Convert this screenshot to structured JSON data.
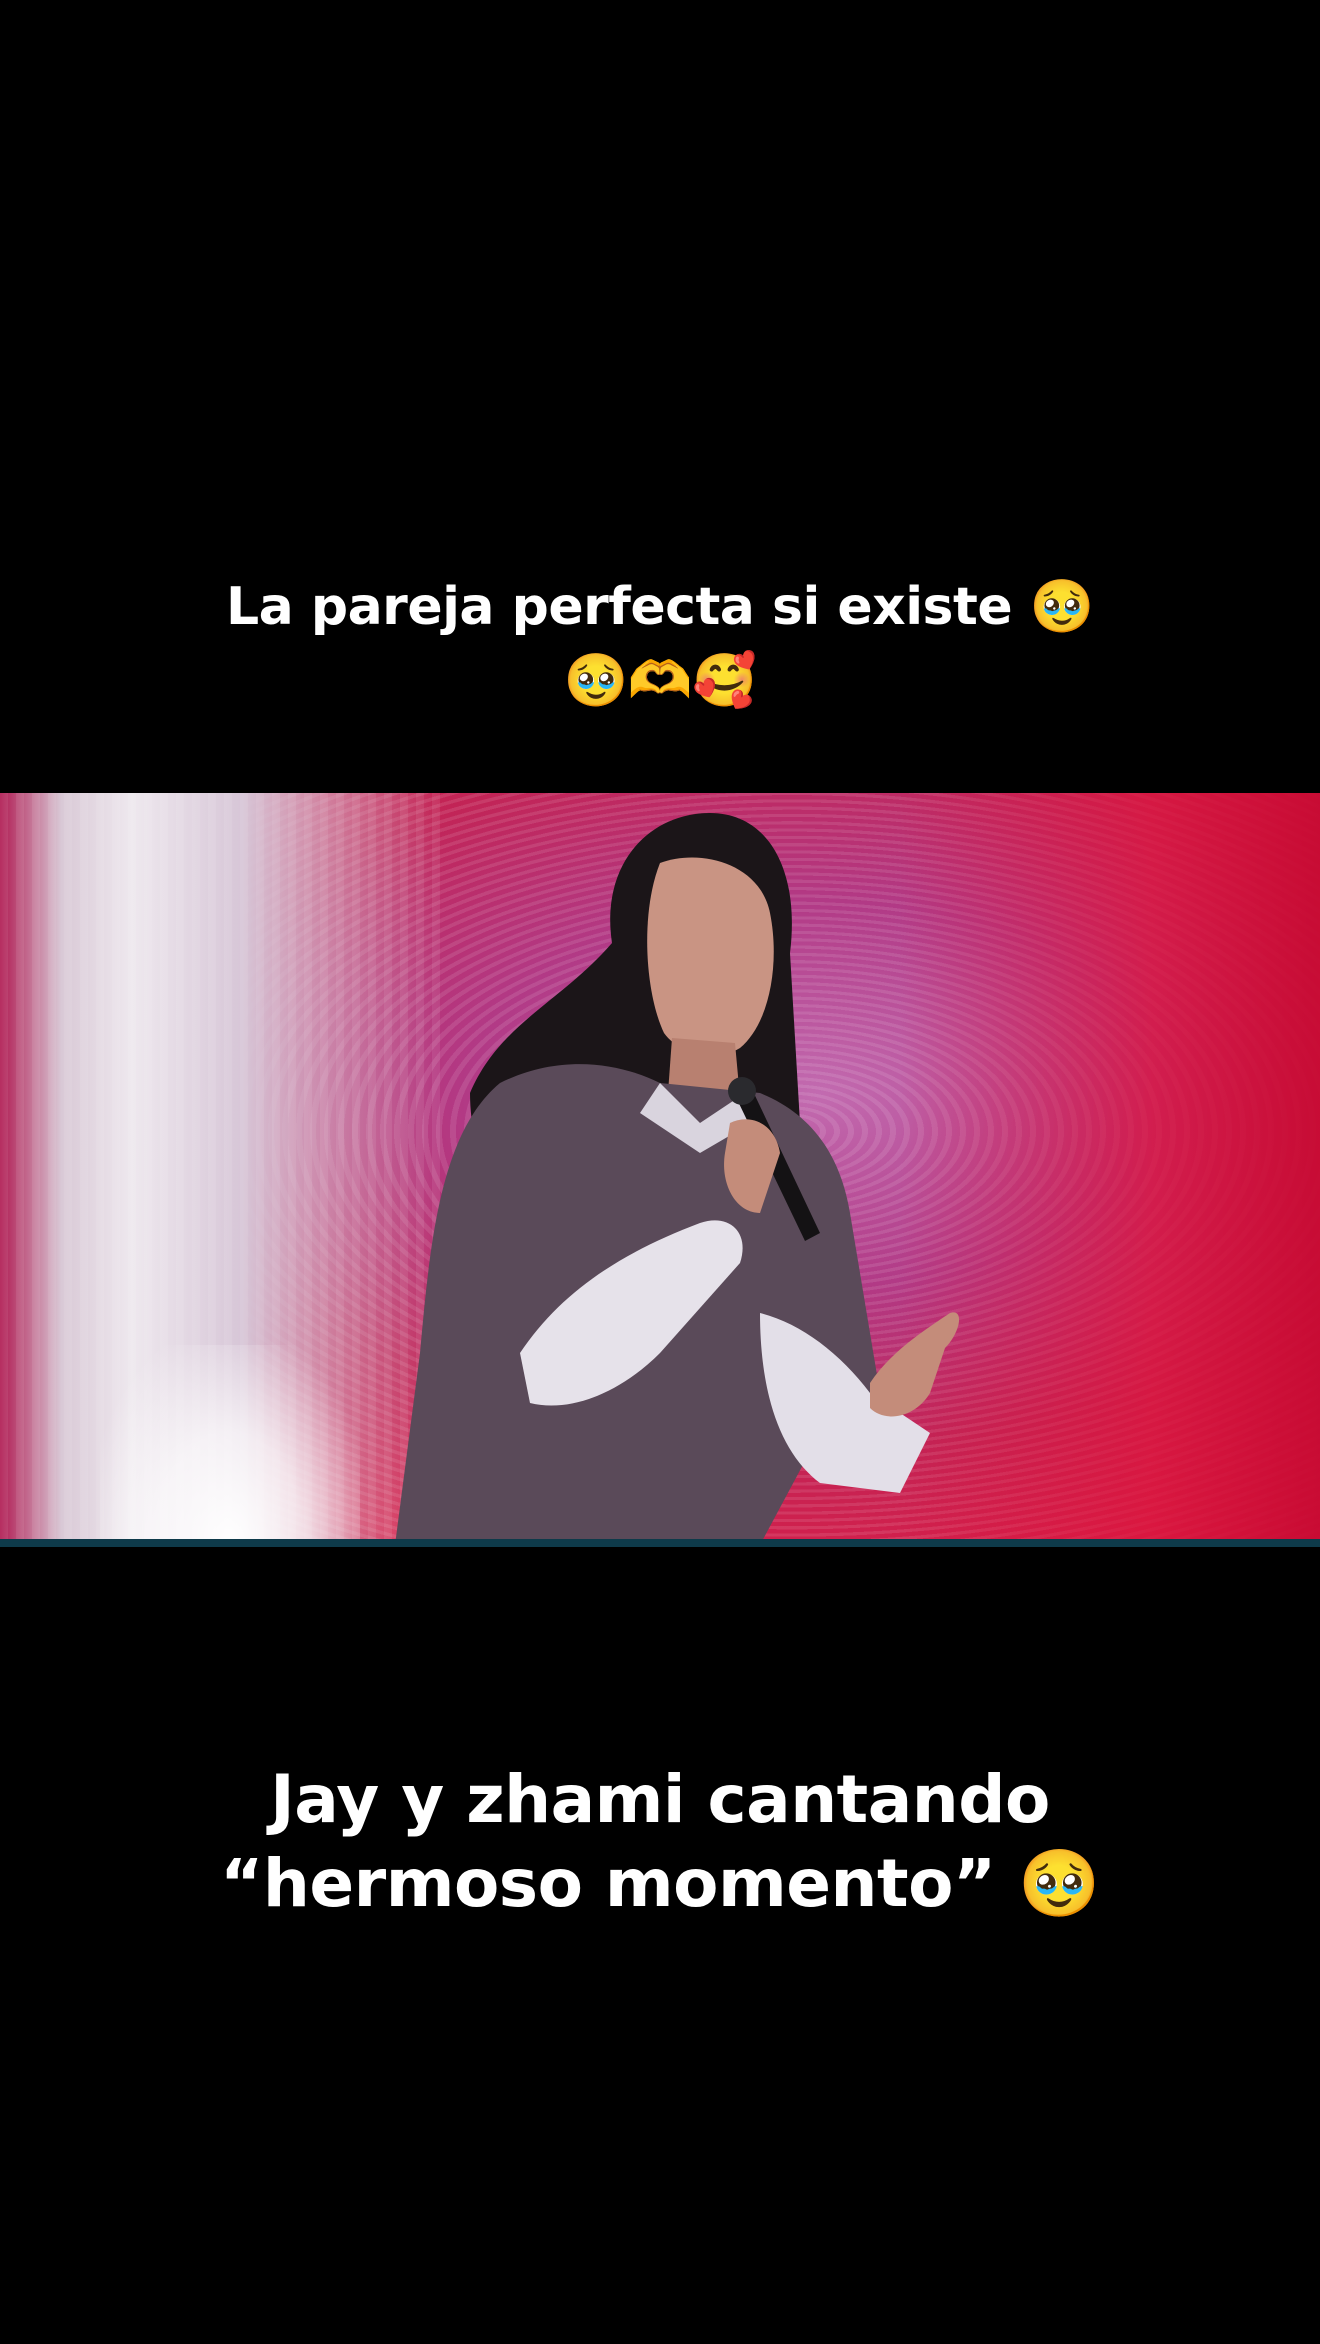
{
  "overlay_text": {
    "top_line1": "La pareja perfecta si existe 🥹",
    "top_line2": "🥹🫶🥰",
    "bottom_line1": "Jay y zhami cantando",
    "bottom_line2": "“hermoso momento” 🥹"
  },
  "colors": {
    "background": "#000000",
    "text": "#ffffff",
    "video_bar": "#0e3a4a"
  }
}
